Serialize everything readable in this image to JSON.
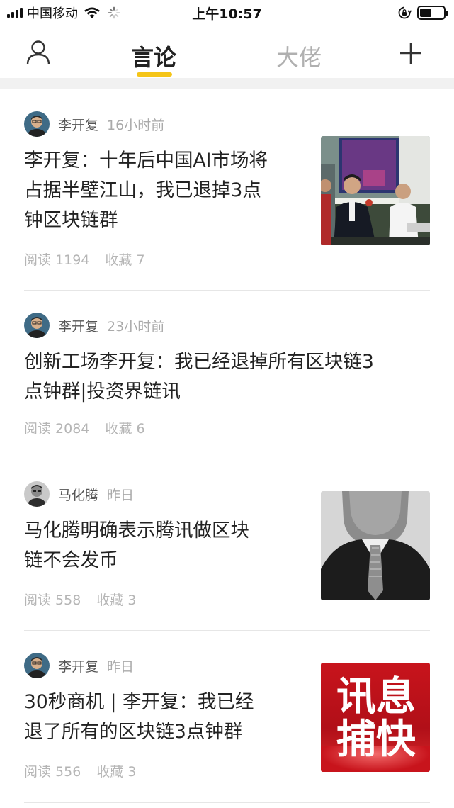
{
  "status_bar": {
    "carrier": "中国移动",
    "time": "上午10:57"
  },
  "nav": {
    "tabs": [
      {
        "label": "言论",
        "active": true
      },
      {
        "label": "大佬",
        "active": false
      }
    ],
    "accent_color": "#f5c518"
  },
  "articles": [
    {
      "author": "李开复",
      "time": "16小时前",
      "title_lines": [
        "李开复：十年后中国AI市场将",
        "占据半壁江山，我已退掉3点",
        "钟区块链群"
      ],
      "read_label": "阅读 1194",
      "fav_label": "收藏 7",
      "has_thumbnail": true
    },
    {
      "author": "李开复",
      "time": "23小时前",
      "title_lines": [
        "创新工场李开复：我已经退掉所有区块链3",
        "点钟群|投资界链讯"
      ],
      "read_label": "阅读 2084",
      "fav_label": "收藏 6",
      "has_thumbnail": false
    },
    {
      "author": "马化腾",
      "time": "昨日",
      "title_lines": [
        "马化腾明确表示腾讯做区块",
        "链不会发币"
      ],
      "read_label": "阅读 558",
      "fav_label": "收藏 3",
      "has_thumbnail": true
    },
    {
      "author": "李开复",
      "time": "昨日",
      "title_lines": [
        "30秒商机 | 李开复：我已经",
        "退了所有的区块链3点钟群"
      ],
      "read_label": "阅读 556",
      "fav_label": "收藏 3",
      "has_thumbnail": true,
      "thumbnail_text": [
        "讯息",
        "捕快"
      ]
    }
  ]
}
